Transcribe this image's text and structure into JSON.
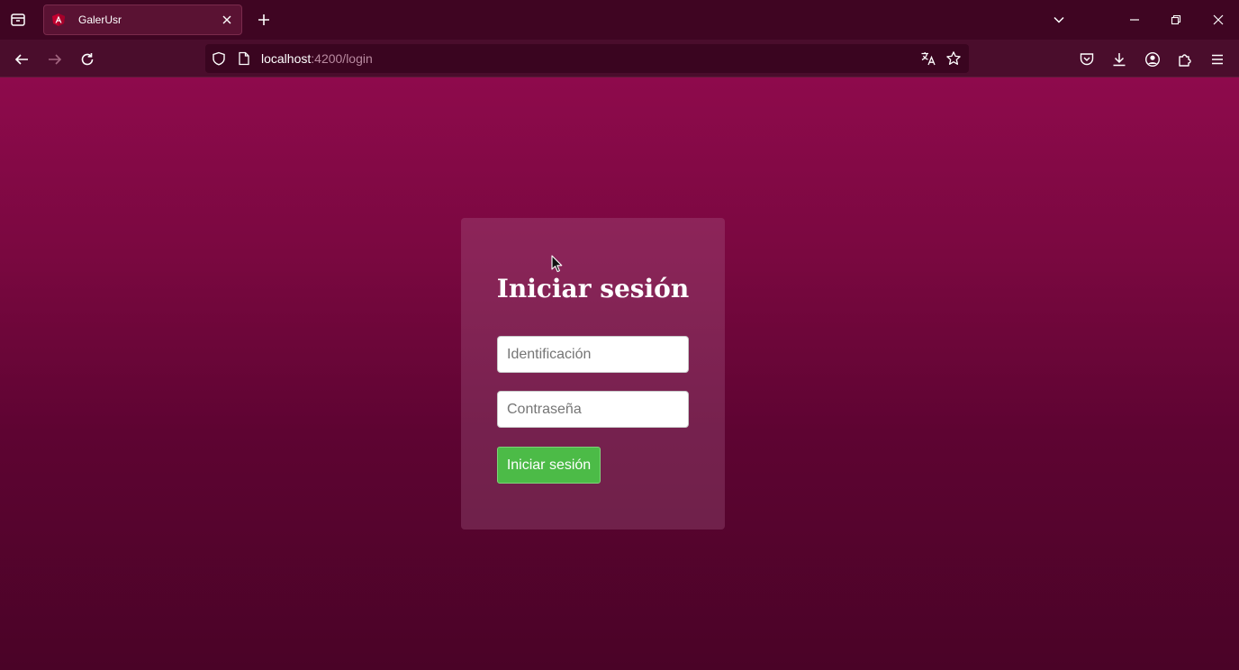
{
  "browser": {
    "tab": {
      "title": "GalerUsr",
      "favicon": "angular-logo-icon"
    },
    "url": {
      "host": "localhost",
      "path": ":4200/login"
    },
    "icons": [
      "list-all-tabs-icon",
      "close-icon",
      "new-tab-icon",
      "chevron-down-icon",
      "minimize-icon",
      "restore-icon",
      "close-window-icon",
      "back-arrow-icon",
      "forward-arrow-icon",
      "reload-icon",
      "shield-icon",
      "page-icon",
      "translate-icon",
      "star-icon",
      "pocket-icon",
      "download-icon",
      "account-icon",
      "extensions-icon",
      "menu-icon"
    ]
  },
  "login": {
    "title": "Iniciar sesión",
    "id_placeholder": "Identificación",
    "password_placeholder": "Contraseña",
    "submit_label": "Iniciar sesión"
  },
  "colors": {
    "page_gradient_top": "#8e0a4c",
    "page_gradient_bottom": "#4a0327",
    "button": "#4cbb47",
    "chrome": "#3f0522"
  }
}
